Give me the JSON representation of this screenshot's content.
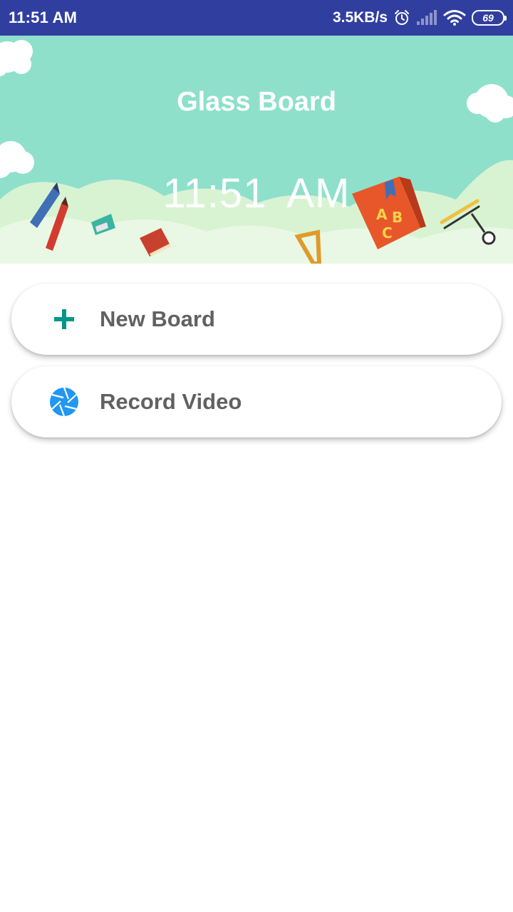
{
  "status_bar": {
    "time": "11:51 AM",
    "net_speed": "3.5KB/s",
    "battery": "69",
    "icons": [
      "alarm-icon",
      "signal-icon",
      "wifi-icon",
      "battery-icon"
    ],
    "bg_color": "#303F9F"
  },
  "header": {
    "title": "Glass Board",
    "clock": "11:51 AM",
    "bg_color": "#8EE0CB"
  },
  "menu": {
    "items": [
      {
        "label": "New Board",
        "icon": "plus-icon",
        "icon_color": "#009688"
      },
      {
        "label": "Record Video",
        "icon": "camera-shutter-icon",
        "icon_color": "#2196F3"
      }
    ]
  }
}
